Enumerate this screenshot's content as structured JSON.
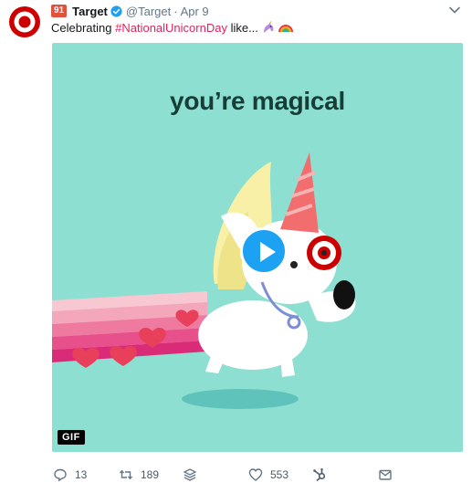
{
  "tweet": {
    "badge": "91",
    "name": "Target",
    "handle": "@Target",
    "separator": "·",
    "date": "Apr 9",
    "text_prefix": "Celebrating ",
    "hashtag": "#NationalUnicornDay",
    "text_suffix": " like...",
    "emojis": [
      "unicorn-emoji",
      "rainbow-emoji"
    ]
  },
  "media": {
    "title": "you’re magical",
    "gif_label": "GIF",
    "background": "#8ddfd1"
  },
  "actions": {
    "reply_count": "13",
    "retweet_count": "189",
    "like_count": "553"
  },
  "colors": {
    "brand_red": "#cc0000",
    "hashtag": "#e0245e",
    "play_button": "#1da1f2",
    "verified": "#1da1f2"
  }
}
